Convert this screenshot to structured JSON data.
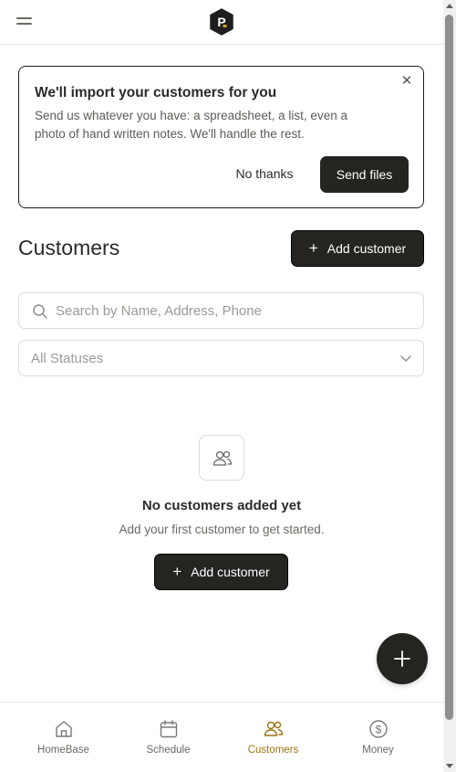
{
  "header": {
    "menu_icon": "hamburger-icon",
    "logo_icon": "app-logo-icon",
    "logo_letter": "P"
  },
  "import_banner": {
    "title": "We'll import your customers for you",
    "body": "Send us whatever you have: a spreadsheet, a list, even a photo of hand written notes. We'll handle the rest.",
    "dismiss_label": "No thanks",
    "send_label": "Send files",
    "close_icon": "close-icon"
  },
  "page": {
    "title": "Customers",
    "add_label": "Add customer"
  },
  "search": {
    "placeholder": "Search by Name, Address, Phone",
    "value": ""
  },
  "status_filter": {
    "selected": "All Statuses"
  },
  "empty_state": {
    "icon": "users-icon",
    "title": "No customers added yet",
    "subtitle": "Add your first customer to get started.",
    "add_label": "Add customer"
  },
  "bottom_nav": {
    "items": [
      {
        "label": "HomeBase",
        "icon": "home-icon"
      },
      {
        "label": "Schedule",
        "icon": "calendar-icon"
      },
      {
        "label": "Customers",
        "icon": "users-icon",
        "active": true
      },
      {
        "label": "Money",
        "icon": "dollar-icon"
      }
    ]
  },
  "colors": {
    "accent": "#9a7412",
    "dark_button": "#262421",
    "border": "#dedcd8"
  }
}
